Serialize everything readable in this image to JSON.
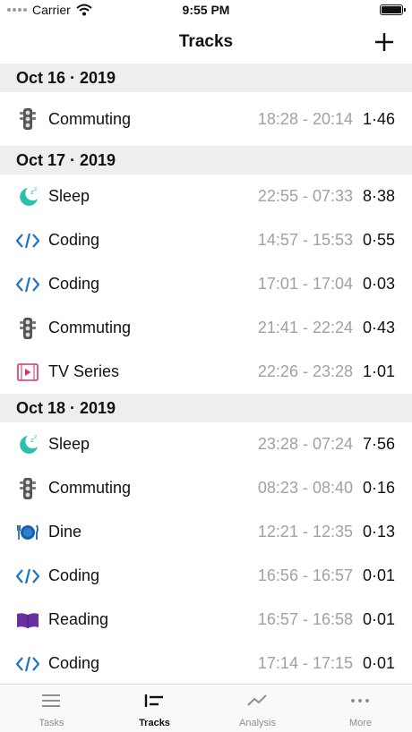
{
  "status_bar": {
    "carrier": "Carrier",
    "time": "9:55 PM"
  },
  "nav": {
    "title": "Tracks"
  },
  "sections": [
    {
      "date": "Oct 16 · 2019",
      "rows": [
        {
          "icon": "traffic-light-icon",
          "name": "Commuting",
          "range": "18:28 - 20:14",
          "duration": "1·46"
        }
      ]
    },
    {
      "date": "Oct 17 · 2019",
      "rows": [
        {
          "icon": "sleep-moon-icon",
          "name": "Sleep",
          "range": "22:55 - 07:33",
          "duration": "8·38"
        },
        {
          "icon": "code-icon",
          "name": "Coding",
          "range": "14:57 - 15:53",
          "duration": "0·55"
        },
        {
          "icon": "code-icon",
          "name": "Coding",
          "range": "17:01 - 17:04",
          "duration": "0·03"
        },
        {
          "icon": "traffic-light-icon",
          "name": "Commuting",
          "range": "21:41 - 22:24",
          "duration": "0·43"
        },
        {
          "icon": "film-play-icon",
          "name": "TV Series",
          "range": "22:26 - 23:28",
          "duration": "1·01"
        }
      ]
    },
    {
      "date": "Oct 18 · 2019",
      "rows": [
        {
          "icon": "sleep-moon-icon",
          "name": "Sleep",
          "range": "23:28 - 07:24",
          "duration": "7·56"
        },
        {
          "icon": "traffic-light-icon",
          "name": "Commuting",
          "range": "08:23 - 08:40",
          "duration": "0·16"
        },
        {
          "icon": "plate-cutlery-icon",
          "name": "Dine",
          "range": "12:21 - 12:35",
          "duration": "0·13"
        },
        {
          "icon": "code-icon",
          "name": "Coding",
          "range": "16:56 - 16:57",
          "duration": "0·01"
        },
        {
          "icon": "book-icon",
          "name": "Reading",
          "range": "16:57 - 16:58",
          "duration": "0·01"
        },
        {
          "icon": "code-icon",
          "name": "Coding",
          "range": "17:14 - 17:15",
          "duration": "0·01"
        }
      ]
    }
  ],
  "tabs": [
    {
      "icon": "list-icon",
      "label": "Tasks",
      "active": false
    },
    {
      "icon": "tracks-icon",
      "label": "Tracks",
      "active": true
    },
    {
      "icon": "trend-line-icon",
      "label": "Analysis",
      "active": false
    },
    {
      "icon": "ellipsis-icon",
      "label": "More",
      "active": false
    }
  ],
  "colors": {
    "code": "#1a73c9",
    "sleep": "#2bbfb0",
    "tv": "#d1356b",
    "book": "#6a2ea0",
    "dine": "#1a5ea8",
    "muted": "#a0a0a5"
  }
}
